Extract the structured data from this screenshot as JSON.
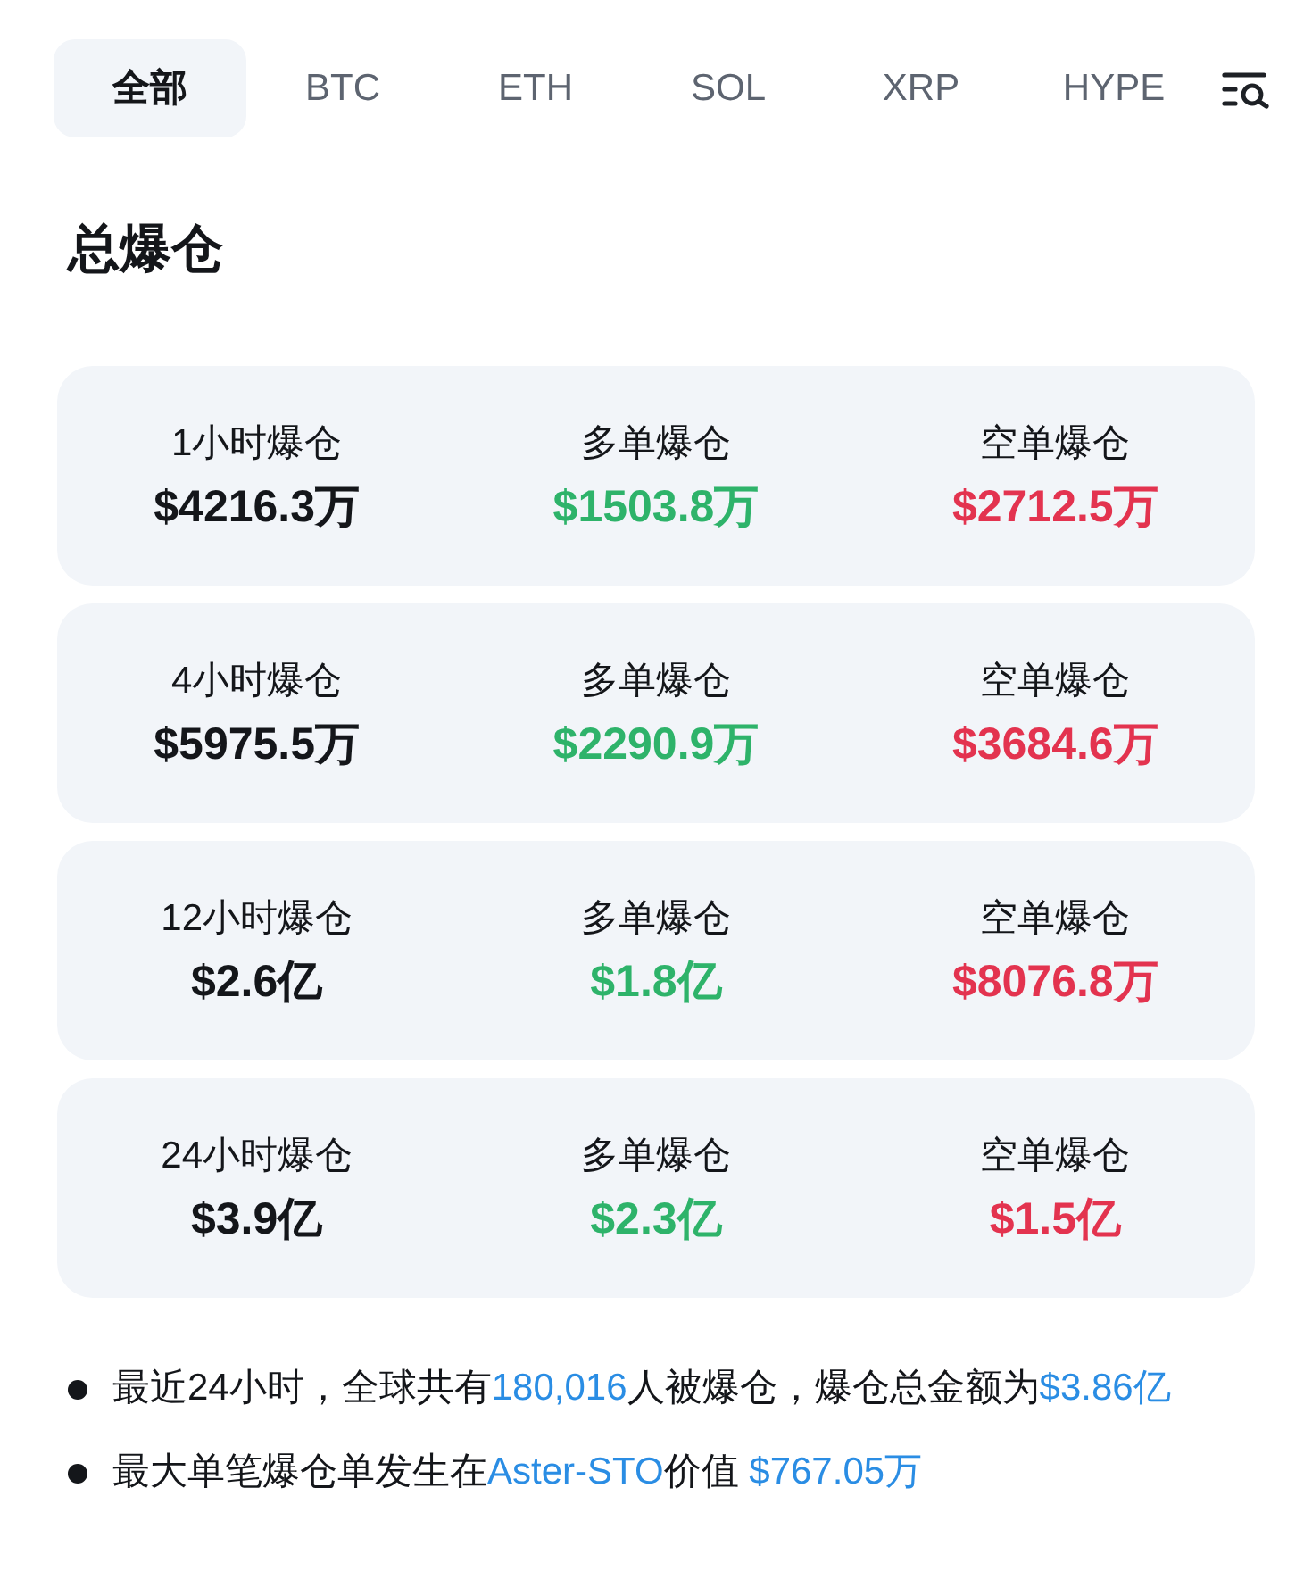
{
  "tabs": [
    {
      "label": "全部",
      "selected": true
    },
    {
      "label": "BTC",
      "selected": false
    },
    {
      "label": "ETH",
      "selected": false
    },
    {
      "label": "SOL",
      "selected": false
    },
    {
      "label": "XRP",
      "selected": false
    },
    {
      "label": "HYPE",
      "selected": false
    }
  ],
  "section_title": "总爆仓",
  "stats": [
    {
      "cells": [
        {
          "label": "1小时爆仓",
          "value": "$4216.3万",
          "kind": "total"
        },
        {
          "label": "多单爆仓",
          "value": "$1503.8万",
          "kind": "long"
        },
        {
          "label": "空单爆仓",
          "value": "$2712.5万",
          "kind": "short"
        }
      ]
    },
    {
      "cells": [
        {
          "label": "4小时爆仓",
          "value": "$5975.5万",
          "kind": "total"
        },
        {
          "label": "多单爆仓",
          "value": "$2290.9万",
          "kind": "long"
        },
        {
          "label": "空单爆仓",
          "value": "$3684.6万",
          "kind": "short"
        }
      ]
    },
    {
      "cells": [
        {
          "label": "12小时爆仓",
          "value": "$2.6亿",
          "kind": "total"
        },
        {
          "label": "多单爆仓",
          "value": "$1.8亿",
          "kind": "long"
        },
        {
          "label": "空单爆仓",
          "value": "$8076.8万",
          "kind": "short"
        }
      ]
    },
    {
      "cells": [
        {
          "label": "24小时爆仓",
          "value": "$3.9亿",
          "kind": "total"
        },
        {
          "label": "多单爆仓",
          "value": "$2.3亿",
          "kind": "long"
        },
        {
          "label": "空单爆仓",
          "value": "$1.5亿",
          "kind": "short"
        }
      ]
    }
  ],
  "notes": [
    {
      "segments": [
        {
          "text": "最近24小时，全球共有",
          "highlight": false
        },
        {
          "text": "180,016",
          "highlight": true
        },
        {
          "text": "人被爆仓，爆仓总金额为",
          "highlight": false
        },
        {
          "text": "$3.86亿",
          "highlight": true
        }
      ]
    },
    {
      "segments": [
        {
          "text": "最大单笔爆仓单发生在",
          "highlight": false
        },
        {
          "text": "Aster-STO",
          "highlight": true
        },
        {
          "text": "价值 ",
          "highlight": false
        },
        {
          "text": "$767.05万",
          "highlight": true
        }
      ]
    }
  ]
}
